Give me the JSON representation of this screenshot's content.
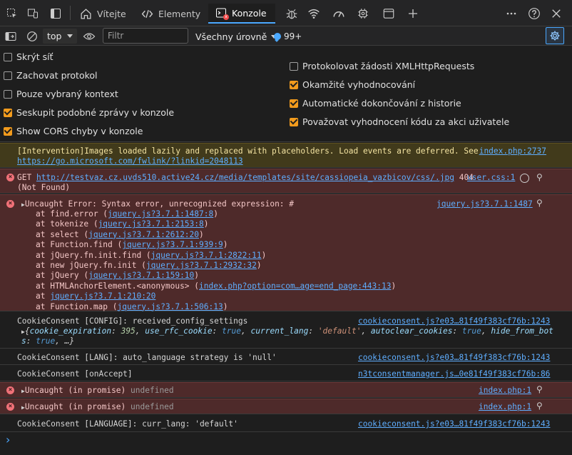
{
  "tabs": {
    "vitejte": "Vítejte",
    "elementy": "Elementy",
    "konzole": "Konzole"
  },
  "toolbar": {
    "context": "top",
    "filter_placeholder": "Filtr",
    "levels": "Všechny úrovně",
    "issue_count": "99+"
  },
  "settings": {
    "left": [
      {
        "label": "Skrýt síť",
        "checked": false
      },
      {
        "label": "Zachovat protokol",
        "checked": false
      },
      {
        "label": "Pouze vybraný kontext",
        "checked": false
      },
      {
        "label": "Seskupit podobné zprávy v konzole",
        "checked": true
      },
      {
        "label": "Show CORS chyby v konzole",
        "checked": true
      }
    ],
    "right": [
      {
        "label": "Protokolovat žádosti XMLHttpRequests",
        "checked": false
      },
      {
        "label": "Okamžité vyhodnocování",
        "checked": true
      },
      {
        "label": "Automatické dokončování z historie",
        "checked": true
      },
      {
        "label": "Považovat vyhodnocení kódu za akci uživatele",
        "checked": true
      }
    ]
  },
  "console": {
    "intervention": {
      "line1": "[Intervention]Images loaded lazily and replaced with placeholders. Load events are deferred. See",
      "line2": "https://go.microsoft.com/fwlink/?linkid=2048113",
      "source": "index.php:2737"
    },
    "get_error": {
      "method": "GET",
      "url": "http://testvaz.cz.uvds510.active24.cz/media/templates/site/cassiopeia_vazbicov/css/.jpg",
      "status": "404",
      "status_text": "(Not Found)",
      "source": "user.css:1"
    },
    "syntax_error": {
      "message": "Uncaught Error: Syntax error, unrecognized expression: #",
      "source": "jquery.js?3.7.1:1487",
      "stack": [
        {
          "fn": "at find.error (",
          "loc": "jquery.js?3.7.1:1487:8",
          "end": ")"
        },
        {
          "fn": "at tokenize (",
          "loc": "jquery.js?3.7.1:2153:8",
          "end": ")"
        },
        {
          "fn": "at select (",
          "loc": "jquery.js?3.7.1:2612:20",
          "end": ")"
        },
        {
          "fn": "at Function.find (",
          "loc": "jquery.js?3.7.1:939:9",
          "end": ")"
        },
        {
          "fn": "at jQuery.fn.init.find (",
          "loc": "jquery.js?3.7.1:2822:11",
          "end": ")"
        },
        {
          "fn": "at new jQuery.fn.init (",
          "loc": "jquery.js?3.7.1:2932:32",
          "end": ")"
        },
        {
          "fn": "at jQuery (",
          "loc": "jquery.js?3.7.1:159:10",
          "end": ")"
        },
        {
          "fn": "at HTMLAnchorElement.<anonymous> (",
          "loc": "index.php?option=com…age=end_page:443:13",
          "end": ")"
        },
        {
          "fn": "at ",
          "loc": "jquery.js?3.7.1:210:20",
          "end": ""
        },
        {
          "fn": "at Function.map (",
          "loc": "jquery.js?3.7.1:506:13",
          "end": ")"
        }
      ]
    },
    "config": {
      "message": "CookieConsent [CONFIG]: received_config_settings",
      "source": "cookieconsent.js?e03…81f49f383cf76b:1243",
      "obj_line1_prefix": "{",
      "k1": "cookie_expiration",
      "v1": "395",
      "k2": "use_rfc_cookie",
      "v2": "true",
      "k3": "current_lang",
      "v3": "'default'",
      "k4": "autoclear_cookies",
      "v4": "true",
      "k5": "hide_from_bot",
      "k5b": "s",
      "v5": "true",
      "tail": ", …}"
    },
    "lang": {
      "message": "CookieConsent [LANG]: auto_language strategy is 'null'",
      "source": "cookieconsent.js?e03…81f49f383cf76b:1243"
    },
    "accept": {
      "message": "CookieConsent [onAccept]",
      "source": "n3tconsentmanager.js…0e81f49f383cf76b:86"
    },
    "promise1": {
      "message": "Uncaught (in promise)",
      "detail": "undefined",
      "source": "index.php:1"
    },
    "promise2": {
      "message": "Uncaught (in promise)",
      "detail": "undefined",
      "source": "index.php:1"
    },
    "language": {
      "message": "CookieConsent [LANGUAGE]: curr_lang: 'default'",
      "source": "cookieconsent.js?e03…81f49f383cf76b:1243"
    },
    "prompt": "›"
  }
}
